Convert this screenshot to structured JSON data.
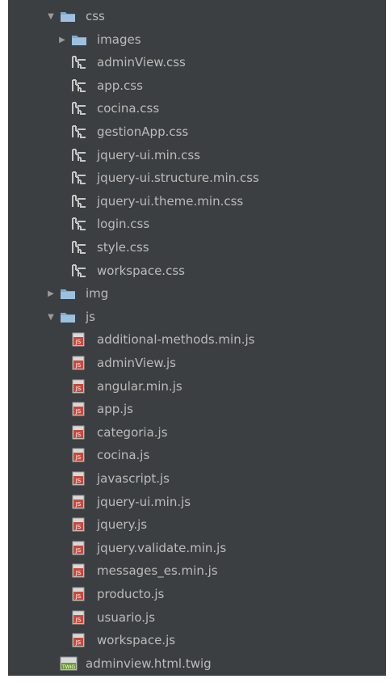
{
  "tree": {
    "css_folder": {
      "label": "css",
      "state": "expanded",
      "icon": "folder-icon"
    },
    "css_children": [
      {
        "label": "images",
        "type": "folder",
        "state": "collapsed"
      },
      {
        "label": "adminView.css",
        "type": "css"
      },
      {
        "label": "app.css",
        "type": "css"
      },
      {
        "label": "cocina.css",
        "type": "css"
      },
      {
        "label": "gestionApp.css",
        "type": "css"
      },
      {
        "label": "jquery-ui.min.css",
        "type": "css"
      },
      {
        "label": "jquery-ui.structure.min.css",
        "type": "css"
      },
      {
        "label": "jquery-ui.theme.min.css",
        "type": "css"
      },
      {
        "label": "login.css",
        "type": "css"
      },
      {
        "label": "style.css",
        "type": "css"
      },
      {
        "label": "workspace.css",
        "type": "css"
      }
    ],
    "img_folder": {
      "label": "img",
      "state": "collapsed",
      "icon": "folder-icon"
    },
    "js_folder": {
      "label": "js",
      "state": "expanded",
      "icon": "folder-icon"
    },
    "js_children": [
      {
        "label": "additional-methods.min.js",
        "type": "js"
      },
      {
        "label": "adminView.js",
        "type": "js"
      },
      {
        "label": "angular.min.js",
        "type": "js"
      },
      {
        "label": "app.js",
        "type": "js"
      },
      {
        "label": "categoria.js",
        "type": "js"
      },
      {
        "label": "cocina.js",
        "type": "js"
      },
      {
        "label": "javascript.js",
        "type": "js"
      },
      {
        "label": "jquery-ui.min.js",
        "type": "js"
      },
      {
        "label": "jquery.js",
        "type": "js"
      },
      {
        "label": "jquery.validate.min.js",
        "type": "js"
      },
      {
        "label": "messages_es.min.js",
        "type": "js"
      },
      {
        "label": "producto.js",
        "type": "js"
      },
      {
        "label": "usuario.js",
        "type": "js"
      },
      {
        "label": "workspace.js",
        "type": "js"
      }
    ],
    "twig_file": {
      "label": "adminview.html.twig",
      "type": "twig",
      "badge": "TWIG"
    }
  },
  "colors": {
    "panel_bg": "#3c3f41",
    "text": "#bbbbbb",
    "folder_blue": "#7fa9cc",
    "js_red": "#c9493c"
  }
}
